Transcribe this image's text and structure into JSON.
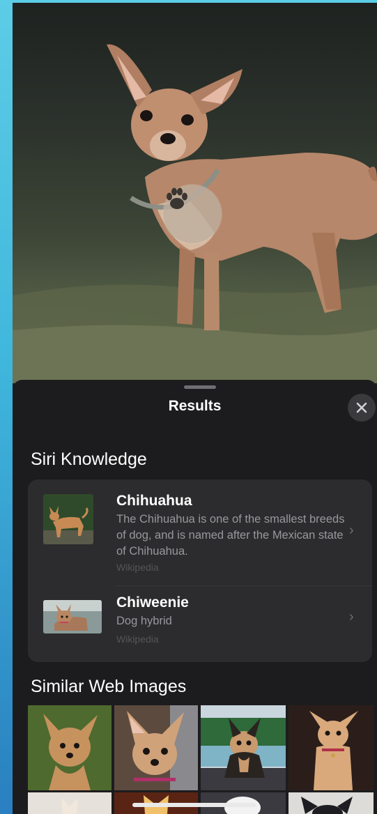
{
  "visual_lookup": {
    "badge_icon": "paw-icon"
  },
  "sheet": {
    "title": "Results",
    "close_icon": "close-icon"
  },
  "siri_knowledge": {
    "heading": "Siri Knowledge",
    "items": [
      {
        "title": "Chihuahua",
        "description": "The Chihuahua is one of the smallest breeds of dog, and is named after the Mexican state of Chihuahua.",
        "source": "Wikipedia"
      },
      {
        "title": "Chiweenie",
        "description": "Dog hybrid",
        "source": "Wikipedia"
      }
    ]
  },
  "similar_images": {
    "heading": "Similar Web Images"
  },
  "colors": {
    "sheet_bg": "#1c1c1e",
    "card_bg": "#2c2c2e",
    "secondary_text": "#98989d",
    "tertiary_text": "#555559"
  }
}
